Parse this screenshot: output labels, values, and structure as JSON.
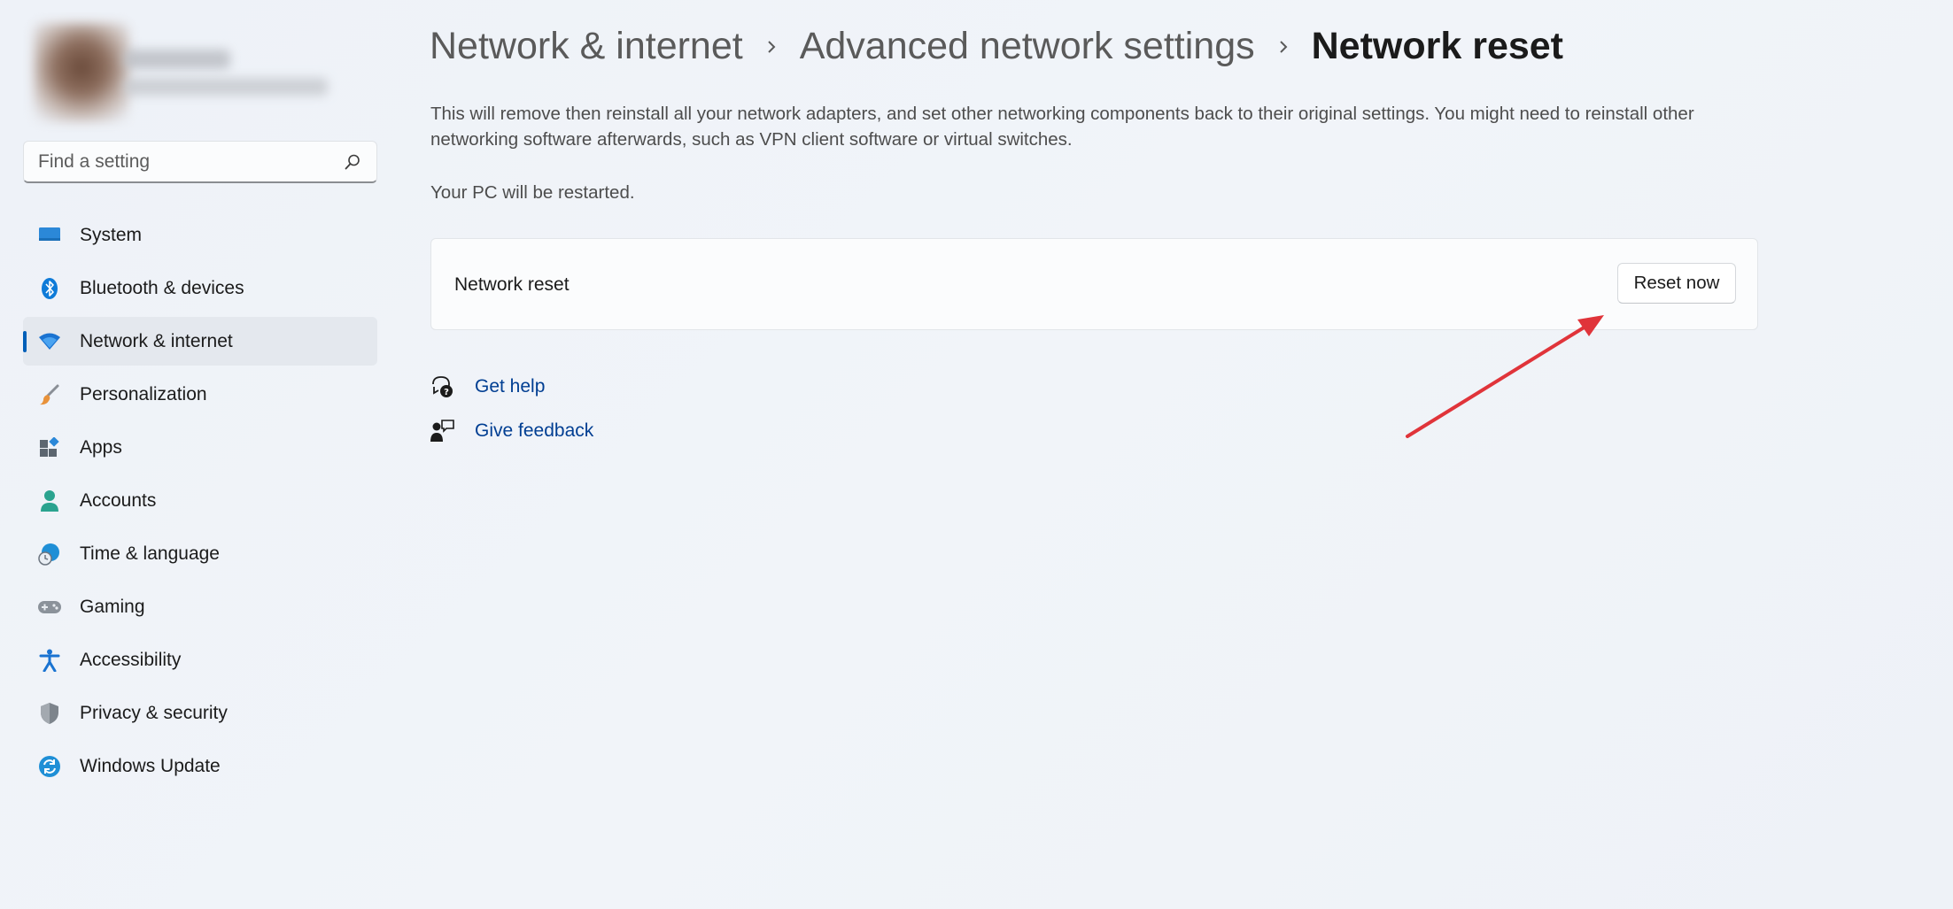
{
  "search": {
    "placeholder": "Find a setting"
  },
  "sidebar": {
    "items": [
      {
        "label": "System",
        "icon": "monitor-icon"
      },
      {
        "label": "Bluetooth & devices",
        "icon": "bluetooth-icon"
      },
      {
        "label": "Network & internet",
        "icon": "wifi-icon",
        "active": true
      },
      {
        "label": "Personalization",
        "icon": "brush-icon"
      },
      {
        "label": "Apps",
        "icon": "apps-icon"
      },
      {
        "label": "Accounts",
        "icon": "person-icon"
      },
      {
        "label": "Time & language",
        "icon": "globe-clock-icon"
      },
      {
        "label": "Gaming",
        "icon": "gamepad-icon"
      },
      {
        "label": "Accessibility",
        "icon": "accessibility-icon"
      },
      {
        "label": "Privacy & security",
        "icon": "shield-icon"
      },
      {
        "label": "Windows Update",
        "icon": "update-icon"
      }
    ]
  },
  "breadcrumb": {
    "level1": "Network & internet",
    "level2": "Advanced network settings",
    "current": "Network reset"
  },
  "main": {
    "description": "This will remove then reinstall all your network adapters, and set other networking components back to their original settings. You might need to reinstall other networking software afterwards, such as VPN client software or virtual switches.",
    "restart_note": "Your PC will be restarted.",
    "card": {
      "label": "Network reset",
      "button": "Reset now"
    },
    "help": {
      "get_help": "Get help",
      "give_feedback": "Give feedback"
    }
  },
  "colors": {
    "accent": "#005fb8",
    "link": "#003e92",
    "annotation_arrow": "#e0343a"
  }
}
